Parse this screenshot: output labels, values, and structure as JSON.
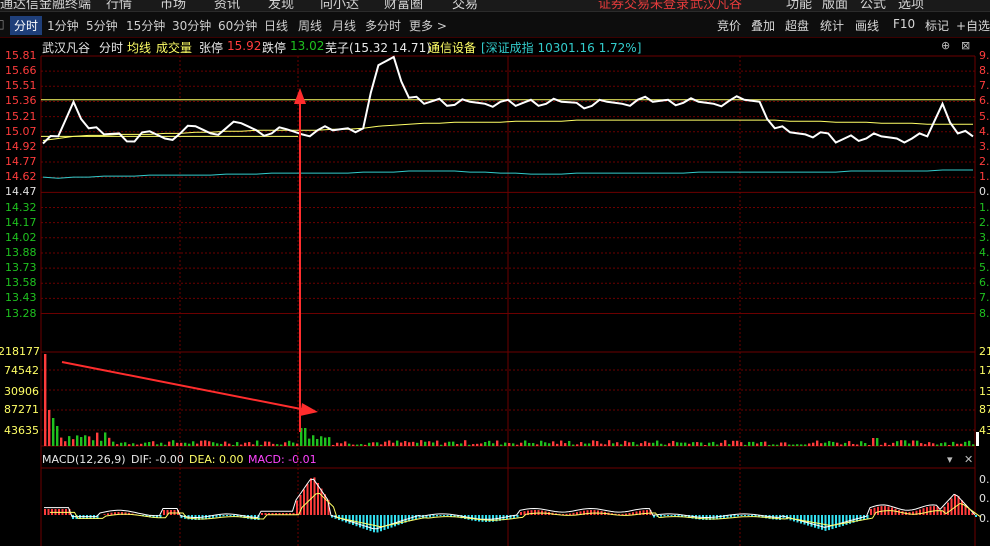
{
  "menubar": {
    "app_title": "通达信金融终端",
    "items": [
      "行情",
      "市场",
      "资讯",
      "发现",
      "向小达",
      "财富圈",
      "交易"
    ],
    "warning": "证券交易未登录",
    "stock_tag": "武汉凡谷",
    "right_items": [
      "功能",
      "版面",
      "公式",
      "选项"
    ]
  },
  "tabs": {
    "items": [
      "分时",
      "1分钟",
      "5分钟",
      "15分钟",
      "30分钟",
      "60分钟",
      "日线",
      "周线",
      "月线",
      "多分时",
      "更多 >"
    ],
    "active": "分时"
  },
  "right_tools": [
    "竞价",
    "叠加",
    "超盘",
    "统计",
    "画线",
    "F10",
    "标记",
    "+自选"
  ],
  "info": {
    "stock_name": "武汉凡谷",
    "mode": "分时",
    "avg_label": "均线",
    "vol_label": "成交量",
    "limit_up_label": "张停",
    "limit_up": "15.92",
    "limit_down_label": "跌停",
    "limit_down": "13.02",
    "tag": "芜子(15.32 14.71)",
    "sector": "通信设备",
    "index_text": "[深证成指 10301.16 1.72%]"
  },
  "price_axis": [
    "15.81",
    "15.66",
    "15.51",
    "15.36",
    "15.21",
    "15.07",
    "14.92",
    "14.77",
    "14.62",
    "14.47",
    "14.32",
    "14.17",
    "14.02",
    "13.88",
    "13.73",
    "13.58",
    "13.43",
    "13.28"
  ],
  "pct_axis": [
    "9.",
    "8.",
    "7.",
    "6.",
    "5.",
    "4.",
    "3.",
    "2.",
    "1.",
    "0.",
    "1.",
    "2.",
    "3.",
    "4.",
    "5.",
    "6.",
    "7.",
    "8."
  ],
  "volume_axis": [
    "218177",
    "74542",
    "30906",
    "87271",
    "43635"
  ],
  "volume_axis_right": [
    "21",
    "17",
    "13",
    "87",
    "43"
  ],
  "macd": {
    "label": "MACD(12,26,9)",
    "dif": "DIF: -0.00",
    "dea": "DEA: 0.00",
    "macd": "MACD: -0.01",
    "right_axis": [
      "0.",
      "0.",
      "0."
    ]
  },
  "colors": {
    "up": "#ff3c3c",
    "down": "#1fc11f",
    "price_line": "#ffffff",
    "avg_line": "#ffff66",
    "index_line": "#33cccc",
    "grid": "#6b0000",
    "macd_neg": "#33e0f0",
    "arrow": "#ff2d2d"
  },
  "chart_data": {
    "type": "line",
    "series": [
      {
        "price": [
          14.95,
          15.02,
          15.36,
          15.1,
          15.04,
          15.05,
          14.97,
          15.07,
          15.0,
          15.05,
          15.12,
          15.05,
          15.1,
          15.15,
          15.08,
          15.05,
          15.09,
          15.04,
          15.08,
          15.08,
          15.1,
          15.1,
          15.72,
          15.8,
          15.4,
          15.34,
          15.39,
          15.33,
          15.36,
          15.34,
          15.36,
          15.32,
          15.38,
          15.34,
          15.36,
          15.35,
          15.32,
          15.36,
          15.34,
          15.38,
          15.36,
          15.38,
          15.35,
          15.36,
          15.34,
          15.37,
          15.38,
          15.36,
          15.1,
          15.06,
          15.04,
          15.06,
          14.96,
          15.03,
          15.0,
          15.02,
          15.0,
          15.0,
          15.02,
          15.34,
          15.05,
          15.02
        ]
      },
      {
        "avg": [
          14.98,
          15.0,
          15.02,
          15.03,
          15.03,
          15.04,
          15.04,
          15.04,
          15.05,
          15.05,
          15.06,
          15.06,
          15.07,
          15.07,
          15.08,
          15.08,
          15.08,
          15.08,
          15.08,
          15.09,
          15.09,
          15.1,
          15.12,
          15.13,
          15.14,
          15.15,
          15.15,
          15.16,
          15.16,
          15.16,
          15.16,
          15.17,
          15.17,
          15.17,
          15.17,
          15.18,
          15.18,
          15.18,
          15.18,
          15.18,
          15.18,
          15.18,
          15.18,
          15.18,
          15.18,
          15.18,
          15.18,
          15.18,
          15.18,
          15.17,
          15.17,
          15.17,
          15.16,
          15.16,
          15.16,
          15.15,
          15.15,
          15.15,
          15.14,
          15.14,
          15.14,
          15.14
        ]
      },
      {
        "index": [
          14.62,
          14.61,
          14.62,
          14.62,
          14.63,
          14.63,
          14.63,
          14.64,
          14.64,
          14.64,
          14.64,
          14.64,
          14.65,
          14.65,
          14.65,
          14.66,
          14.66,
          14.66,
          14.66,
          14.66,
          14.66,
          14.67,
          14.67,
          14.67,
          14.68,
          14.68,
          14.68,
          14.68,
          14.67,
          14.67,
          14.66,
          14.66,
          14.65,
          14.65,
          14.65,
          14.66,
          14.66,
          14.66,
          14.66,
          14.66,
          14.66,
          14.66,
          14.66,
          14.67,
          14.67,
          14.67,
          14.67,
          14.67,
          14.67,
          14.67,
          14.67,
          14.67,
          14.67,
          14.68,
          14.68,
          14.68,
          14.68,
          14.68,
          14.68,
          14.69,
          14.69,
          14.69
        ]
      }
    ],
    "ylim": [
      13.28,
      15.81
    ]
  }
}
